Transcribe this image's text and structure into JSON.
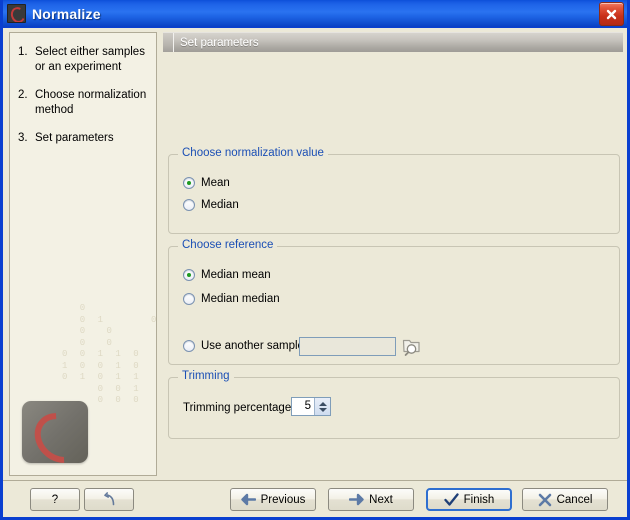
{
  "window": {
    "title": "Normalize",
    "icon": "clc-logo-icon",
    "close_label": "Close"
  },
  "sidebar": {
    "steps": [
      {
        "num": "1.",
        "label": "Select either samples or an experiment"
      },
      {
        "num": "2.",
        "label": "Choose normalization method"
      },
      {
        "num": "3.",
        "label": "Set parameters"
      }
    ],
    "watermark": "  0\n  0 1     0\n  0  0     1\n  0  0     1\n0 0 1 1 0\n1 0 0 1 0\n0 1 0 1 1\n    0 0 1\n    0 0 0  0",
    "logo": "clc-bio-logo"
  },
  "main": {
    "header_title": "Set parameters",
    "groups": [
      {
        "id": "normalization-value",
        "title": "Choose normalization value",
        "options": [
          {
            "label": "Mean",
            "checked": true
          },
          {
            "label": "Median",
            "checked": false
          }
        ]
      },
      {
        "id": "reference",
        "title": "Choose reference",
        "options": [
          {
            "label": "Median mean",
            "checked": true
          },
          {
            "label": "Median median",
            "checked": false
          },
          {
            "label": "Use another sample",
            "checked": false
          }
        ],
        "sample_field": {
          "value": "",
          "placeholder": ""
        },
        "browse_icon": "folder-search-icon"
      },
      {
        "id": "trimming",
        "title": "Trimming",
        "field_label": "Trimming percentage",
        "field_value": "5"
      }
    ]
  },
  "buttons": {
    "help": "?",
    "reset": "",
    "previous": "Previous",
    "next": "Next",
    "finish": "Finish",
    "cancel": "Cancel"
  },
  "colors": {
    "titlebar_blue": "#1e63e8",
    "window_border": "#0a3fd0",
    "panel_bg": "#ece9d8",
    "group_title": "#1b4fb5",
    "radio_dot_green": "#1f9a22",
    "close_red": "#c8301a",
    "focus_blue": "#2f6fd0"
  }
}
